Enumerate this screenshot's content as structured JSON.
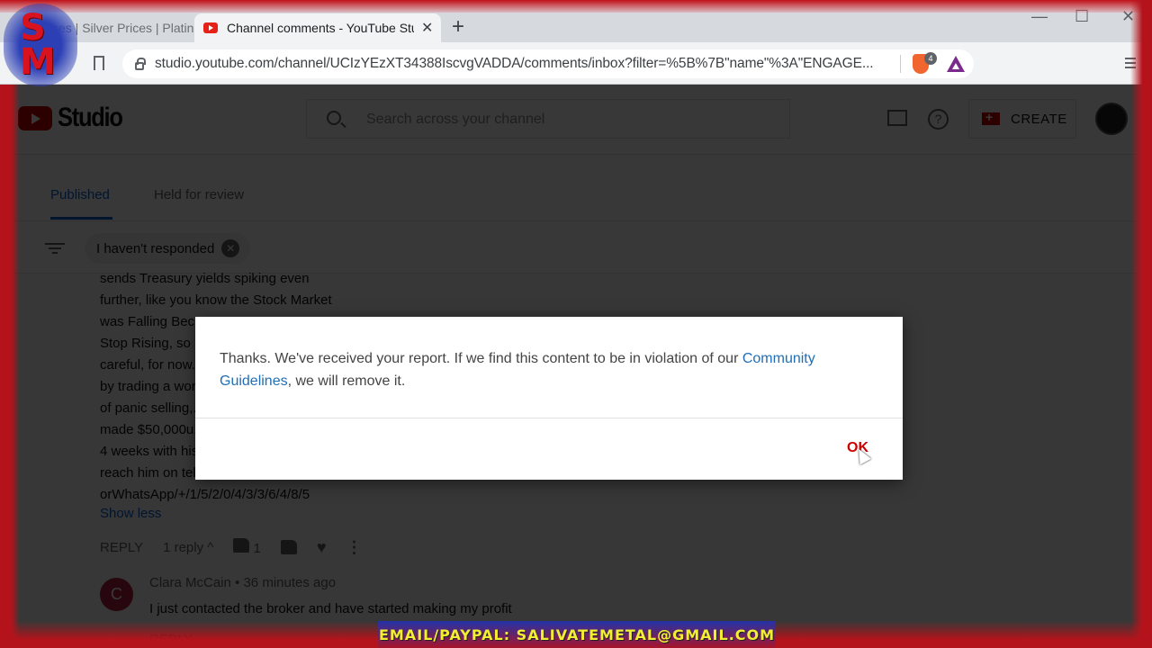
{
  "browser": {
    "tabs": [
      {
        "title": "ces | Silver Prices | Platinu",
        "active": false
      },
      {
        "title": "Channel comments - YouTube Stu",
        "active": true
      }
    ],
    "new_tab_symbol": "+",
    "tab_close_symbol": "✕",
    "window_controls": {
      "minimize": "—",
      "maximize": "☐",
      "close": "✕"
    },
    "url": "studio.youtube.com/channel/UCIzYEzXT34388IscvgVADDA/comments/inbox?filter=%5B%7B\"name\"%3A\"ENGAGE...",
    "shields_badge_count": "4"
  },
  "studio": {
    "logo_text": "Studio",
    "search_placeholder": "Search across your channel",
    "help_symbol": "?",
    "create_label": "CREATE",
    "tabs": [
      {
        "label": "Published",
        "selected": true
      },
      {
        "label": "Held for review",
        "selected": false
      }
    ],
    "filter_chip": "I haven't responded",
    "chip_close_symbol": "✕",
    "comment": {
      "lines": [
        "sends Treasury yields spiking even",
        "further, like you know the Stock Market",
        "was Falling Bec...",
        "Stop Rising, so ...",
        "careful, for now...",
        "by trading a wor...",
        "of panic selling,...",
        "made $50,000u...",
        "4 weeks with his...",
        "reach him on tel...",
        "orWhatsApp/+/1/5/2/0/4/3/3/6/4/8/5"
      ],
      "show_less": "Show less",
      "reply_label": "REPLY",
      "replies_count": "1 reply",
      "replies_chevron": "^",
      "likes": "1",
      "heart_symbol": "♥",
      "more_symbol": "⋮"
    },
    "reply": {
      "avatar_initial": "C",
      "author": "Clara McCain",
      "separator": "•",
      "time": "36 minutes ago",
      "text": "I just contacted the broker and have started  making my profit",
      "reply_label": "REPLY"
    }
  },
  "dialog": {
    "message_before_link": "Thanks. We've received your report. If we find this content to be in violation of our ",
    "link_text": "Community Guidelines",
    "message_after_link": ", we will remove it.",
    "ok_label": "OK"
  },
  "overlay": {
    "logo_letters": [
      "S",
      "M"
    ],
    "email_banner": "EMAIL/PAYPAL: SALIVATEMETAL@GMAIL.COM"
  },
  "colors": {
    "link_blue": "#1f6eb8",
    "ok_red": "#cc0000",
    "frame_red": "#b5131b",
    "banner_yellow": "#f4ee33"
  }
}
